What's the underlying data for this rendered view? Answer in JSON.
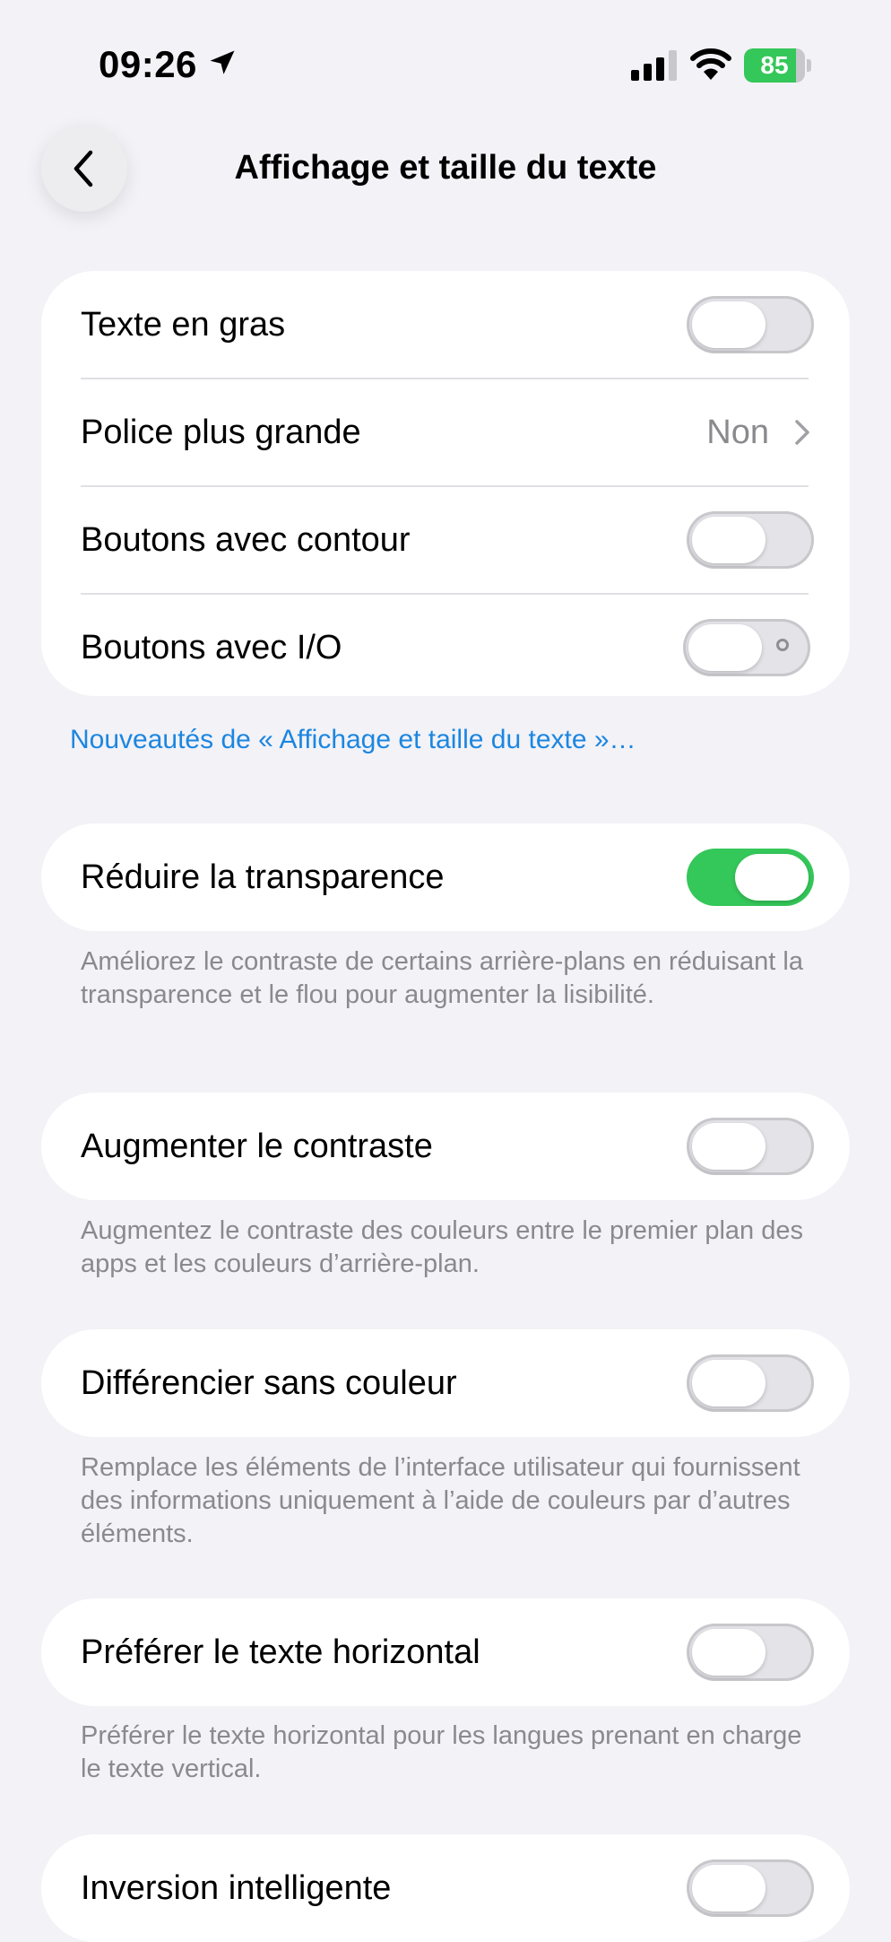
{
  "status_bar": {
    "time": "09:26",
    "battery_level": "85",
    "battery_fraction": 0.85,
    "location_icon": "location-arrow-icon",
    "signal_icon": "cellular-signal-icon",
    "wifi_icon": "wifi-icon",
    "battery_color": "#34c759"
  },
  "nav": {
    "title": "Affichage et taille du texte",
    "back_icon": "chevron-left-icon"
  },
  "group1": {
    "rows": [
      {
        "label": "Texte en gras",
        "toggle": false
      },
      {
        "label": "Police plus grande",
        "value": "Non"
      },
      {
        "label": "Boutons avec contour",
        "toggle": false
      },
      {
        "label": "Boutons avec I/O",
        "toggle": false
      }
    ],
    "link": "Nouveautés de « Affichage et taille du texte »…"
  },
  "groups": [
    {
      "label": "Réduire la transparence",
      "toggle": true,
      "footnote": "Améliorez le contraste de certains arrière-plans en réduisant la transparence et le flou pour augmenter la lisibilité."
    },
    {
      "label": "Augmenter le contraste",
      "toggle": false,
      "footnote": "Augmentez le contraste des couleurs entre le premier plan des apps et les couleurs d’arrière-plan."
    },
    {
      "label": "Différencier sans couleur",
      "toggle": false,
      "footnote": "Remplace les éléments de l’interface utilisateur qui fournissent des informations uniquement à l’aide de couleurs par d’autres éléments."
    },
    {
      "label": "Préférer le texte horizontal",
      "toggle": false,
      "footnote": "Préférer le texte horizontal pour les langues prenant en charge le texte vertical."
    },
    {
      "label": "Inversion intelligente",
      "toggle": false
    }
  ],
  "colors": {
    "accent_link": "#1c86e0",
    "toggle_on": "#34c759",
    "background": "#f2f2f7"
  }
}
